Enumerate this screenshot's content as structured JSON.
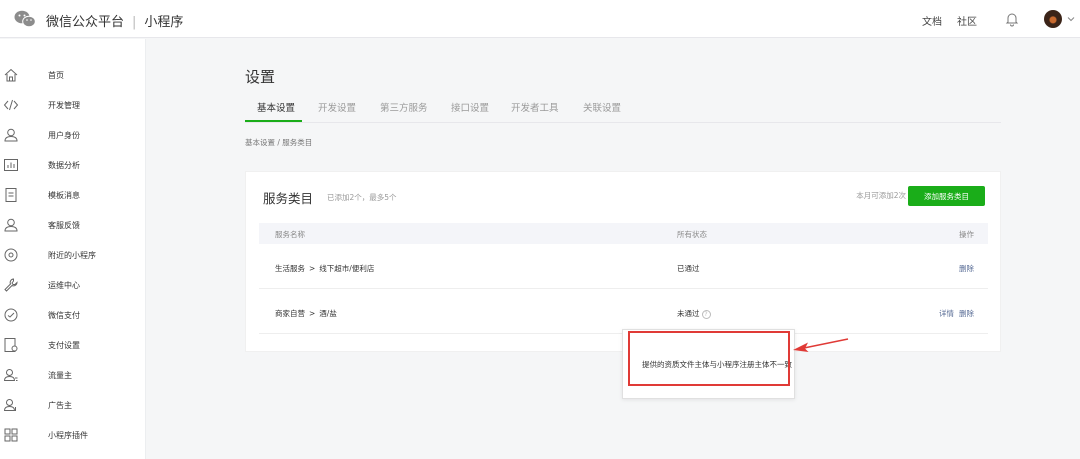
{
  "header": {
    "brand": "微信公众平台",
    "separator": "|",
    "product": "小程序",
    "links": [
      {
        "label": "文档"
      },
      {
        "label": "社区"
      }
    ]
  },
  "sidebar": {
    "items": [
      {
        "label": "首页",
        "icon": "home-icon"
      },
      {
        "label": "开发管理",
        "icon": "code-icon"
      },
      {
        "label": "用户身份",
        "icon": "user-icon"
      },
      {
        "label": "数据分析",
        "icon": "chart-icon"
      },
      {
        "label": "模板消息",
        "icon": "document-icon"
      },
      {
        "label": "客服反馈",
        "icon": "support-icon"
      },
      {
        "label": "附近的小程序",
        "icon": "location-icon"
      },
      {
        "label": "运维中心",
        "icon": "wrench-icon"
      },
      {
        "label": "微信支付",
        "icon": "payment-icon"
      },
      {
        "label": "支付设置",
        "icon": "payment-settings-icon"
      },
      {
        "label": "流量主",
        "icon": "traffic-icon"
      },
      {
        "label": "广告主",
        "icon": "advertiser-icon"
      },
      {
        "label": "小程序插件",
        "icon": "plugin-icon"
      }
    ]
  },
  "main": {
    "title": "设置",
    "tabs": [
      {
        "label": "基本设置",
        "active": true
      },
      {
        "label": "开发设置",
        "active": false
      },
      {
        "label": "第三方服务",
        "active": false
      },
      {
        "label": "接口设置",
        "active": false
      },
      {
        "label": "开发者工具",
        "active": false
      },
      {
        "label": "关联设置",
        "active": false
      }
    ],
    "breadcrumb": "基本设置 / 服务类目"
  },
  "service_card": {
    "title": "服务类目",
    "subtitle": "已添加2个，最多5个",
    "quota": "本月可添加2次",
    "add_button": "添加服务类目",
    "columns": [
      "服务名称",
      "所有状态",
      "操作"
    ],
    "rows": [
      {
        "category": "生活服务",
        "sep": ">",
        "subcategory": "线下超市/便利店",
        "status": "已通过",
        "actions": [
          "删除"
        ],
        "help": false
      },
      {
        "category": "商家自营",
        "sep": ">",
        "subcategory": "酒/盐",
        "status": "未通过",
        "actions": [
          "详情",
          "删除"
        ],
        "help": true
      }
    ]
  },
  "tooltip": {
    "text": "提供的资质文件主体与小程序注册主体不一致"
  },
  "colors": {
    "accent": "#1aad19",
    "link": "#576b95",
    "highlight": "#e03a36"
  }
}
